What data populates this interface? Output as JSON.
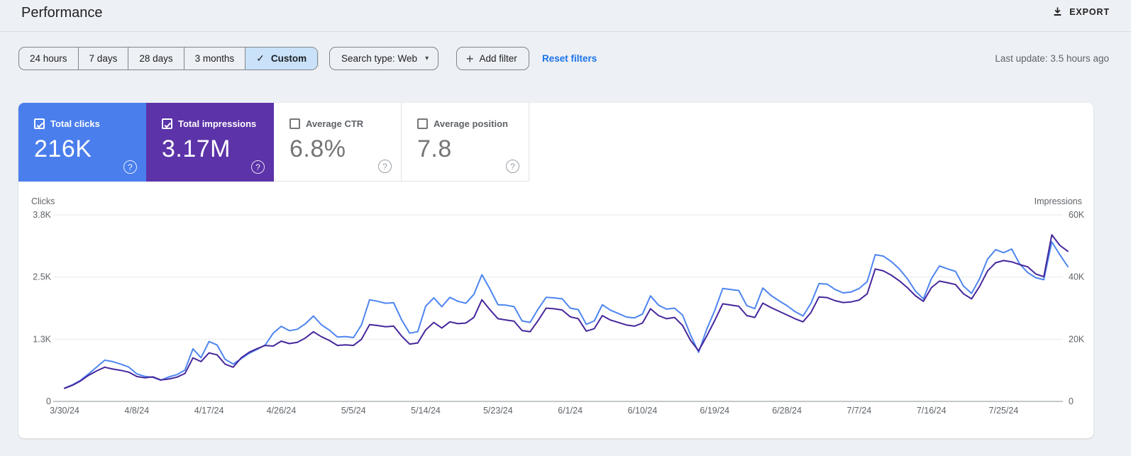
{
  "header": {
    "title": "Performance",
    "export_label": "EXPORT"
  },
  "icons": {
    "check": "✓",
    "plus": "+",
    "caret": "▾",
    "help": "?",
    "download": "download-arrow-tray",
    "checkbox_checked": "checked-box",
    "checkbox_unchecked": "empty-box"
  },
  "filters": {
    "date_ranges": [
      {
        "label": "24 hours",
        "selected": false
      },
      {
        "label": "7 days",
        "selected": false
      },
      {
        "label": "28 days",
        "selected": false
      },
      {
        "label": "3 months",
        "selected": false
      },
      {
        "label": "Custom",
        "selected": true
      }
    ],
    "search_type_label": "Search type: Web",
    "add_filter_label": "Add filter",
    "reset_label": "Reset filters",
    "last_update": "Last update: 3.5 hours ago"
  },
  "metrics": {
    "cards": [
      {
        "label": "Total clicks",
        "value": "216K",
        "checked": true,
        "bg": "#4a7eed",
        "text": "#ffffff"
      },
      {
        "label": "Total impressions",
        "value": "3.17M",
        "checked": true,
        "bg": "#5c33a8",
        "text": "#ffffff"
      },
      {
        "label": "Average CTR",
        "value": "6.8%",
        "checked": false,
        "bg": "#ffffff",
        "text": "#757575"
      },
      {
        "label": "Average position",
        "value": "7.8",
        "checked": false,
        "bg": "#ffffff",
        "text": "#757575"
      }
    ]
  },
  "chart_data": {
    "type": "line",
    "title": "Clicks and impressions over time (daily)",
    "x_start_date": "3/30/24",
    "x_tick_interval_days": 9,
    "x_tick_labels": [
      "3/30/24",
      "4/8/24",
      "4/17/24",
      "4/26/24",
      "5/5/24",
      "5/14/24",
      "5/23/24",
      "6/1/24",
      "6/10/24",
      "6/19/24",
      "6/28/24",
      "7/7/24",
      "7/16/24",
      "7/25/24"
    ],
    "axes": {
      "left": {
        "title": "Clicks",
        "ticks": [
          "3.8K",
          "2.5K",
          "1.3K",
          "0"
        ],
        "range": [
          0,
          3800
        ]
      },
      "right": {
        "title": "Impressions",
        "ticks": [
          "60K",
          "40K",
          "20K",
          "0"
        ],
        "range": [
          0,
          60000
        ]
      }
    },
    "grid": true,
    "legend_position": "none",
    "series": [
      {
        "name": "Clicks",
        "axis": "left",
        "color": "#4e85f0",
        "values": [
          270,
          340,
          430,
          560,
          700,
          840,
          810,
          760,
          700,
          560,
          510,
          490,
          430,
          500,
          545,
          640,
          1070,
          890,
          1220,
          1150,
          860,
          760,
          870,
          980,
          1060,
          1150,
          1390,
          1530,
          1440,
          1470,
          1580,
          1740,
          1560,
          1450,
          1310,
          1320,
          1300,
          1560,
          2070,
          2040,
          2000,
          2010,
          1660,
          1390,
          1420,
          1940,
          2110,
          1930,
          2120,
          2040,
          2000,
          2180,
          2580,
          2290,
          1970,
          1960,
          1930,
          1640,
          1610,
          1880,
          2120,
          2110,
          2090,
          1900,
          1870,
          1570,
          1640,
          1970,
          1860,
          1790,
          1720,
          1700,
          1780,
          2150,
          1960,
          1880,
          1900,
          1760,
          1350,
          1000,
          1470,
          1850,
          2300,
          2280,
          2260,
          1950,
          1890,
          2310,
          2160,
          2050,
          1950,
          1830,
          1740,
          2000,
          2400,
          2390,
          2280,
          2210,
          2230,
          2300,
          2440,
          2990,
          2960,
          2850,
          2700,
          2500,
          2250,
          2090,
          2500,
          2760,
          2700,
          2650,
          2350,
          2200,
          2500,
          2900,
          3090,
          3030,
          3105,
          2800,
          2625,
          2520,
          2480,
          3250,
          2990,
          2745
        ]
      },
      {
        "name": "Impressions",
        "axis": "right",
        "color": "#46279b",
        "values": [
          4200,
          5200,
          6600,
          8400,
          9800,
          11000,
          10400,
          10000,
          9400,
          8000,
          7600,
          7900,
          6900,
          7200,
          7800,
          9000,
          14000,
          12800,
          15600,
          15000,
          12000,
          11000,
          14000,
          15800,
          17000,
          18000,
          17800,
          19400,
          18600,
          19000,
          20400,
          22400,
          20800,
          19600,
          18000,
          18200,
          18000,
          20000,
          24700,
          24400,
          24000,
          24200,
          21000,
          18400,
          18800,
          23000,
          25400,
          23600,
          25600,
          25000,
          25200,
          27000,
          32700,
          29500,
          26600,
          26200,
          25800,
          22800,
          22400,
          26000,
          30000,
          29800,
          29400,
          27200,
          26600,
          22600,
          23400,
          27600,
          26200,
          25400,
          24600,
          24200,
          25200,
          29800,
          27600,
          26600,
          27000,
          24400,
          19600,
          16300,
          21000,
          26000,
          31400,
          31000,
          30600,
          27600,
          27000,
          31600,
          30200,
          29000,
          27800,
          26600,
          25600,
          28600,
          33600,
          33400,
          32400,
          31800,
          32000,
          32600,
          34600,
          42600,
          42000,
          40600,
          38800,
          36600,
          34000,
          32200,
          36600,
          38700,
          38200,
          37600,
          34600,
          33000,
          37000,
          42000,
          44600,
          45300,
          44900,
          44000,
          43300,
          41000,
          40100,
          53600,
          50200,
          48300
        ]
      }
    ]
  }
}
